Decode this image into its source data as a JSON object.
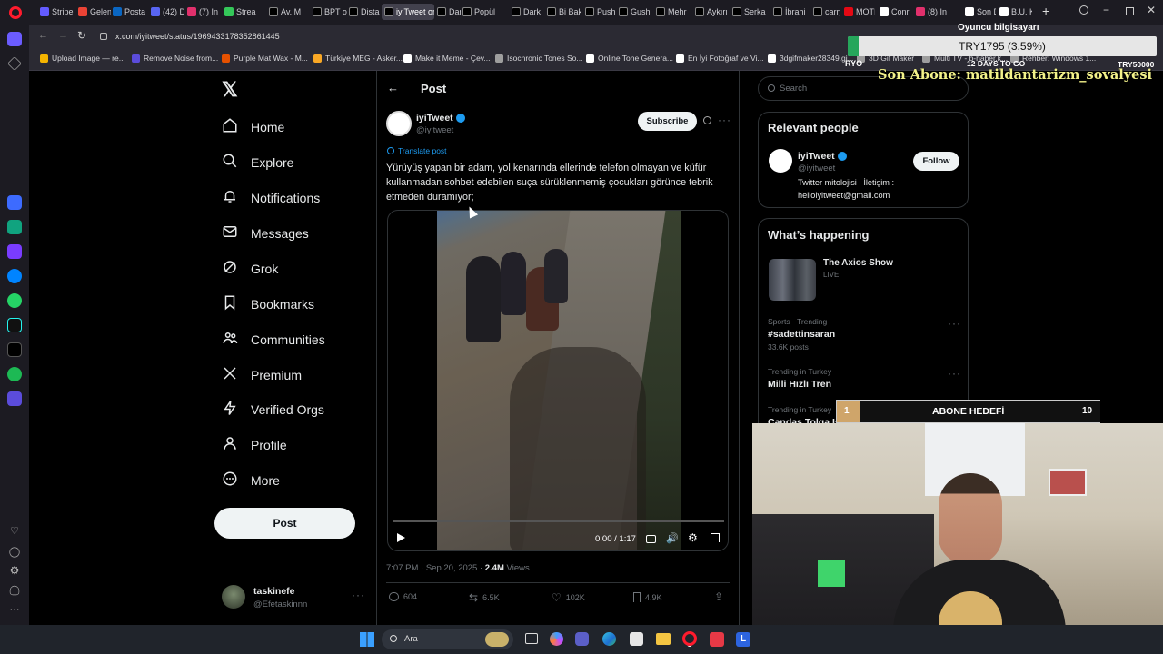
{
  "browser": {
    "tabs": [
      {
        "label": "Stripe",
        "color": "#635bff"
      },
      {
        "label": "Gelen",
        "color": "#ea4335"
      },
      {
        "label": "Posta",
        "color": "#0a66c2"
      },
      {
        "label": "(42) D",
        "color": "#5865f2"
      },
      {
        "label": "(7) In",
        "color": "#e1306c"
      },
      {
        "label": "Strea",
        "color": "#34c759"
      },
      {
        "label": "Av. M",
        "color": "#000000"
      },
      {
        "label": "BPT o",
        "color": "#000000"
      },
      {
        "label": "Dista",
        "color": "#000000"
      },
      {
        "label": "iyiTweet on",
        "color": "#000000"
      },
      {
        "label": "DarkV",
        "color": "#000000"
      },
      {
        "label": "Popül",
        "color": "#000000"
      },
      {
        "label": "Dark",
        "color": "#000000"
      },
      {
        "label": "Bi Bak",
        "color": "#000000"
      },
      {
        "label": "Push",
        "color": "#000000"
      },
      {
        "label": "Gush",
        "color": "#000000"
      },
      {
        "label": "Mehr",
        "color": "#000000"
      },
      {
        "label": "Aykırı",
        "color": "#000000"
      },
      {
        "label": "Serka",
        "color": "#000000"
      },
      {
        "label": "İbrahi",
        "color": "#000000"
      },
      {
        "label": "carry",
        "color": "#000000"
      },
      {
        "label": "MOTI",
        "color": "#e50914"
      },
      {
        "label": "Conr",
        "color": "#ffffff"
      },
      {
        "label": "(8) In",
        "color": "#e1306c"
      },
      {
        "label": "Son D",
        "color": "#ffffff"
      },
      {
        "label": "B.U. K",
        "color": "#ffffff"
      }
    ],
    "url": "x.com/iyitweet/status/1969433178352861445",
    "bookmarks": [
      {
        "label": "Upload Image — re...",
        "color": "#f4b400"
      },
      {
        "label": "Remove Noise from...",
        "color": "#5b4cdb"
      },
      {
        "label": "Purple Mat Wax - M...",
        "color": "#e65100"
      },
      {
        "label": "Türkiye MEG - Asker...",
        "color": "#f9a825"
      },
      {
        "label": "Make it Meme - Çev...",
        "color": "#ffffff"
      },
      {
        "label": "Isochronic Tones So...",
        "color": "#9e9e9e"
      },
      {
        "label": "Online Tone Genera...",
        "color": "#ffffff"
      },
      {
        "label": "En İyi Fotoğraf ve Vi...",
        "color": "#ffffff"
      },
      {
        "label": "3dgifmaker28349.gi...",
        "color": "#ffffff"
      },
      {
        "label": "3D Gif Maker",
        "color": "#9e9e9e"
      },
      {
        "label": "Multi TV - b-haber.k...",
        "color": "#9e9e9e"
      },
      {
        "label": "Rehber: Windows 1...",
        "color": "#9e9e9e"
      }
    ]
  },
  "nav": {
    "items": [
      {
        "label": "Home",
        "icon": "home-icon"
      },
      {
        "label": "Explore",
        "icon": "search-icon"
      },
      {
        "label": "Notifications",
        "icon": "bell-icon"
      },
      {
        "label": "Messages",
        "icon": "mail-icon"
      },
      {
        "label": "Grok",
        "icon": "grok-icon"
      },
      {
        "label": "Bookmarks",
        "icon": "bookmark-icon"
      },
      {
        "label": "Communities",
        "icon": "people-icon"
      },
      {
        "label": "Premium",
        "icon": "x-icon"
      },
      {
        "label": "Verified Orgs",
        "icon": "bolt-icon"
      },
      {
        "label": "Profile",
        "icon": "person-icon"
      },
      {
        "label": "More",
        "icon": "more-circle-icon"
      }
    ],
    "post_button": "Post",
    "account": {
      "name": "taskinefe",
      "handle": "@Efetaskinnn"
    }
  },
  "post": {
    "header_title": "Post",
    "author_name": "iyiTweet",
    "author_handle": "@iyitweet",
    "subscribe_label": "Subscribe",
    "translate_label": "Translate post",
    "text": "Yürüyüş yapan bir adam, yol kenarında ellerinde telefon olmayan ve küfür kullanmadan sohbet edebilen suça sürüklenmemiş çocukları görünce tebrik etmeden duramıyor;",
    "video_time": "0:00 / 1:17",
    "timestamp": "7:07 PM · Sep 20, 2025 · ",
    "views_count": "2.4M",
    "views_label": " Views",
    "replies": "604",
    "reposts": "6.5K",
    "likes": "102K",
    "bookmarks": "4.9K"
  },
  "right": {
    "search_placeholder": "Search",
    "relevant_title": "Relevant people",
    "person_name": "iyiTweet",
    "person_handle": "@iyitweet",
    "follow_label": "Follow",
    "bio_line1": "Twitter mitolojisi | İletişim :",
    "bio_line2": "helloiyitweet@gmail.com",
    "happening_title": "What’s happening",
    "live_show": "The Axios Show",
    "live_label": "LIVE",
    "trends": [
      {
        "category": "Sports · Trending",
        "title": "#sadettinsaran",
        "posts": "33.6K posts"
      },
      {
        "category": "Trending in Turkey",
        "title": "Milli Hızlı Tren",
        "posts": ""
      },
      {
        "category": "Trending in Turkey",
        "title": "Candas Tolga Işı",
        "posts": ""
      }
    ]
  },
  "overlay": {
    "donation_title": "Oyuncu bilgisayarı",
    "donation_amount": "TRY1795 (3.59%)",
    "donation_left": "RYO",
    "donation_mid": "12 DAYS TO GO",
    "donation_right": "TRY50000",
    "last_sub": "Son Abone: matildantarizm_sovalyesi",
    "goal_label": "ABONE HEDEFİ",
    "goal_current": "1",
    "goal_target": "10"
  },
  "taskbar": {
    "search_label": "Ara"
  }
}
